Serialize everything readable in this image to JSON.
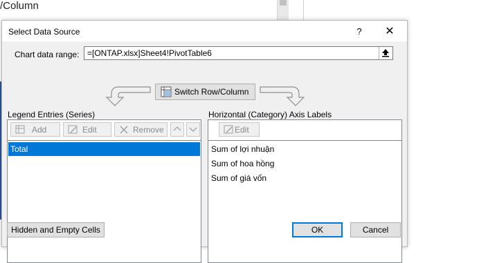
{
  "background": {
    "sheet_text": "/Column"
  },
  "dialog": {
    "title": "Select Data Source",
    "help_label": "?",
    "close_label": "✕",
    "chart_range": {
      "label": "Chart data range:",
      "value": "=[ONTAP.xlsx]Sheet4!PivotTable6"
    },
    "switch_button": "Switch Row/Column",
    "legend": {
      "label": "Legend Entries (Series)",
      "add_label": "Add",
      "edit_label": "Edit",
      "remove_label": "Remove",
      "items": [
        "Total"
      ]
    },
    "category": {
      "label": "Horizontal (Category) Axis Labels",
      "edit_label": "Edit",
      "items": [
        "Sum of lợi nhuận",
        "Sum of hoa hồng",
        "Sum of giá vốn"
      ]
    },
    "hidden_cells_button": "Hidden and Empty Cells",
    "ok_label": "OK",
    "cancel_label": "Cancel"
  },
  "colors": {
    "selection": "#0078d7",
    "dialog_bg": "#f0f0f0",
    "button_bg": "#e1e1e1"
  }
}
